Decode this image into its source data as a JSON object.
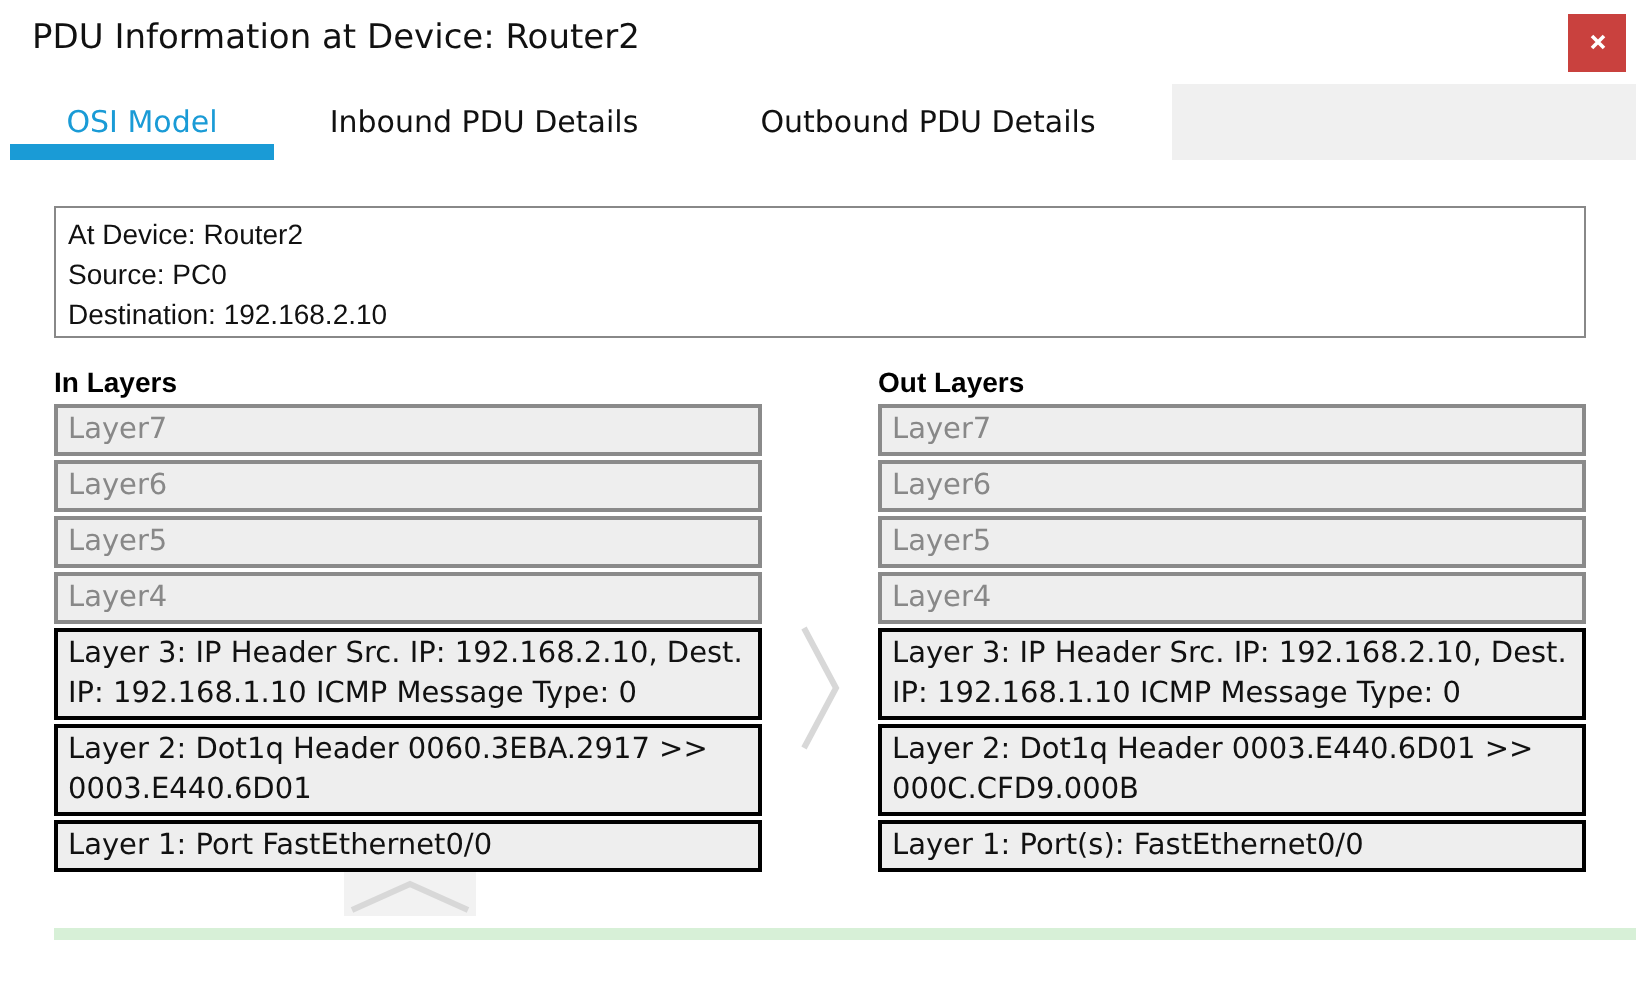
{
  "window": {
    "title": "PDU Information at Device: Router2"
  },
  "tabs": [
    {
      "label": "OSI Model",
      "selected": true
    },
    {
      "label": "Inbound PDU Details",
      "selected": false
    },
    {
      "label": "Outbound PDU Details",
      "selected": false
    }
  ],
  "info": [
    "At Device: Router2",
    "Source: PC0",
    "Destination: 192.168.2.10"
  ],
  "columns": [
    {
      "title": "In Layers",
      "layers": [
        {
          "text": "Layer7",
          "active": false
        },
        {
          "text": "Layer6",
          "active": false
        },
        {
          "text": "Layer5",
          "active": false
        },
        {
          "text": "Layer4",
          "active": false
        },
        {
          "text": "Layer 3: IP Header Src. IP: 192.168.2.10, Dest. IP: 192.168.1.10 ICMP Message Type: 0",
          "active": true
        },
        {
          "text": "Layer 2: Dot1q Header 0060.3EBA.2917 >> 0003.E440.6D01",
          "active": true
        },
        {
          "text": "Layer 1: Port FastEthernet0/0",
          "active": true
        }
      ]
    },
    {
      "title": "Out Layers",
      "layers": [
        {
          "text": "Layer7",
          "active": false
        },
        {
          "text": "Layer6",
          "active": false
        },
        {
          "text": "Layer5",
          "active": false
        },
        {
          "text": "Layer4",
          "active": false
        },
        {
          "text": "Layer 3: IP Header Src. IP: 192.168.2.10, Dest. IP: 192.168.1.10 ICMP Message Type: 0",
          "active": true
        },
        {
          "text": "Layer 2: Dot1q Header 0003.E440.6D01 >> 000C.CFD9.000B",
          "active": true
        },
        {
          "text": "Layer 1: Port(s): FastEthernet0/0",
          "active": true
        }
      ]
    }
  ]
}
